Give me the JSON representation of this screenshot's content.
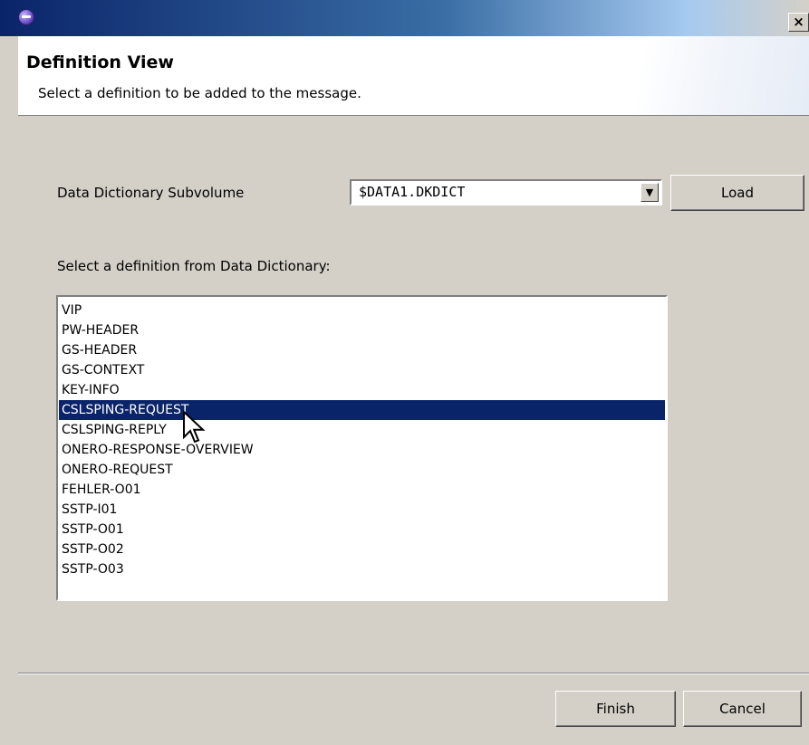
{
  "window": {
    "close_glyph": "×"
  },
  "header": {
    "title": "Definition View",
    "description": "Select a definition to be added to the message."
  },
  "form": {
    "subvolume_label": "Data Dictionary Subvolume",
    "subvolume_value": "$DATA1.DKDICT",
    "load_label": "Load",
    "list_label": "Select a definition from Data Dictionary:"
  },
  "definitions": {
    "selected_index": 5,
    "items": [
      "VIP",
      "PW-HEADER",
      "GS-HEADER",
      "GS-CONTEXT",
      "KEY-INFO",
      "CSLSPING-REQUEST",
      "CSLSPING-REPLY",
      "ONERO-RESPONSE-OVERVIEW",
      "ONERO-REQUEST",
      "FEHLER-O01",
      "SSTP-I01",
      "SSTP-O01",
      "SSTP-O02",
      "SSTP-O03"
    ]
  },
  "footer": {
    "finish_label": "Finish",
    "cancel_label": "Cancel"
  },
  "colors": {
    "title_bar_start": "#0a246a",
    "selection": "#0a246a",
    "dialog_bg": "#d4d0c8"
  },
  "icons": {
    "app": "eclipse-icon",
    "close": "close-icon",
    "dropdown": "dropdown-arrow-icon",
    "cursor": "mouse-pointer-icon"
  }
}
